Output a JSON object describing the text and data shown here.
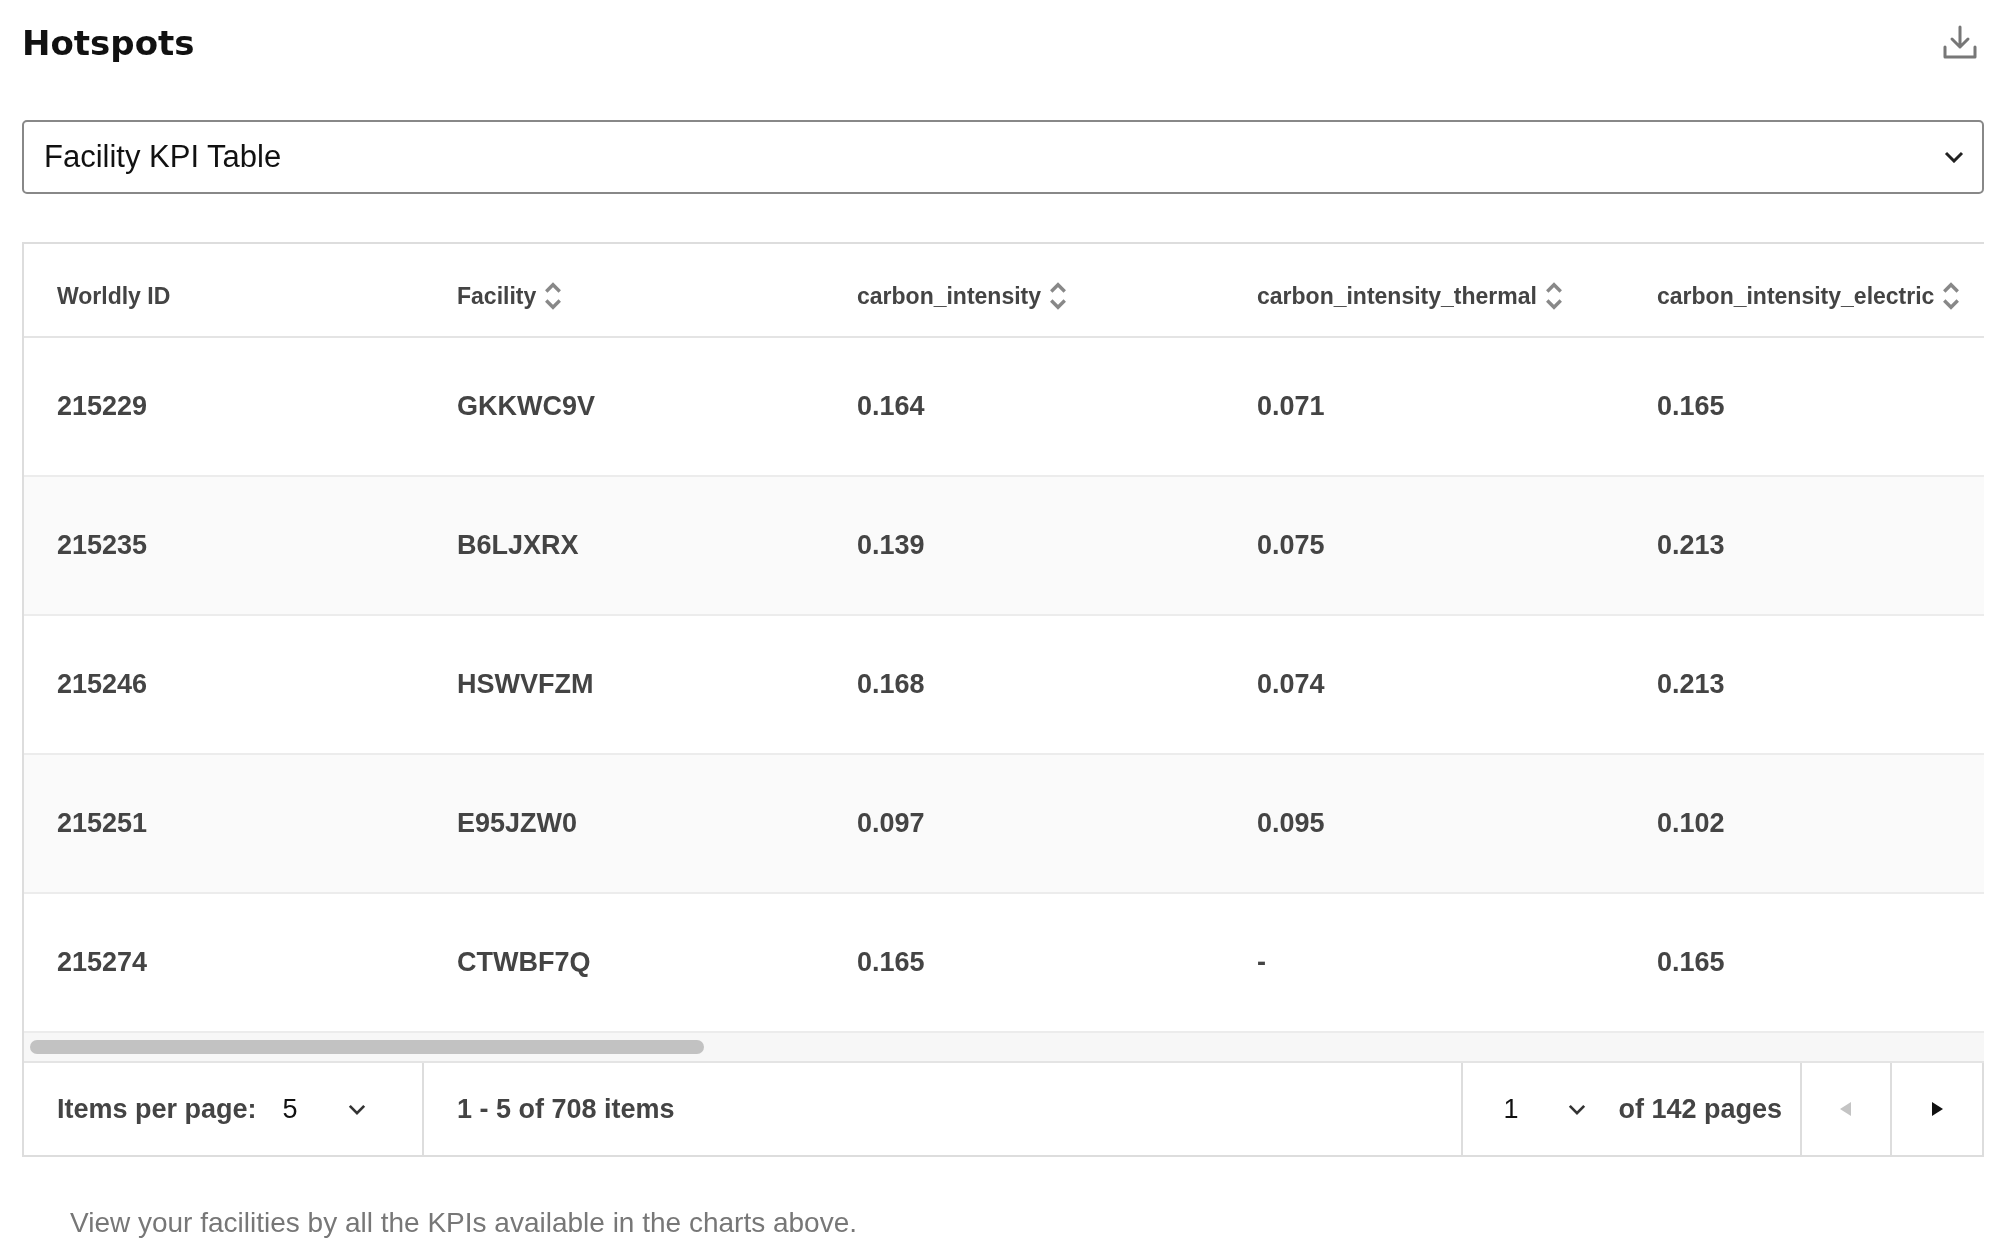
{
  "title": "Hotspots",
  "view_select": {
    "value": "Facility KPI Table"
  },
  "table": {
    "columns": [
      {
        "label": "Worldly ID",
        "sortable": false
      },
      {
        "label": "Facility",
        "sortable": true
      },
      {
        "label": "carbon_intensity",
        "sortable": true
      },
      {
        "label": "carbon_intensity_thermal",
        "sortable": true
      },
      {
        "label": "carbon_intensity_electric",
        "sortable": true
      }
    ],
    "rows": [
      [
        "215229",
        "GKKWC9V",
        "0.164",
        "0.071",
        "0.165"
      ],
      [
        "215235",
        "B6LJXRX",
        "0.139",
        "0.075",
        "0.213"
      ],
      [
        "215246",
        "HSWVFZM",
        "0.168",
        "0.074",
        "0.213"
      ],
      [
        "215251",
        "E95JZW0",
        "0.097",
        "0.095",
        "0.102"
      ],
      [
        "215274",
        "CTWBF7Q",
        "0.165",
        "-",
        "0.165"
      ]
    ]
  },
  "pagination": {
    "items_per_page_label": "Items per page:",
    "items_per_page": "5",
    "range": "1 - 5 of 708 items",
    "page": "1",
    "pages_label": "of 142 pages",
    "prev_disabled": true,
    "next_disabled": false
  },
  "footnote": "View your facilities by all the KPIs available in the charts above."
}
